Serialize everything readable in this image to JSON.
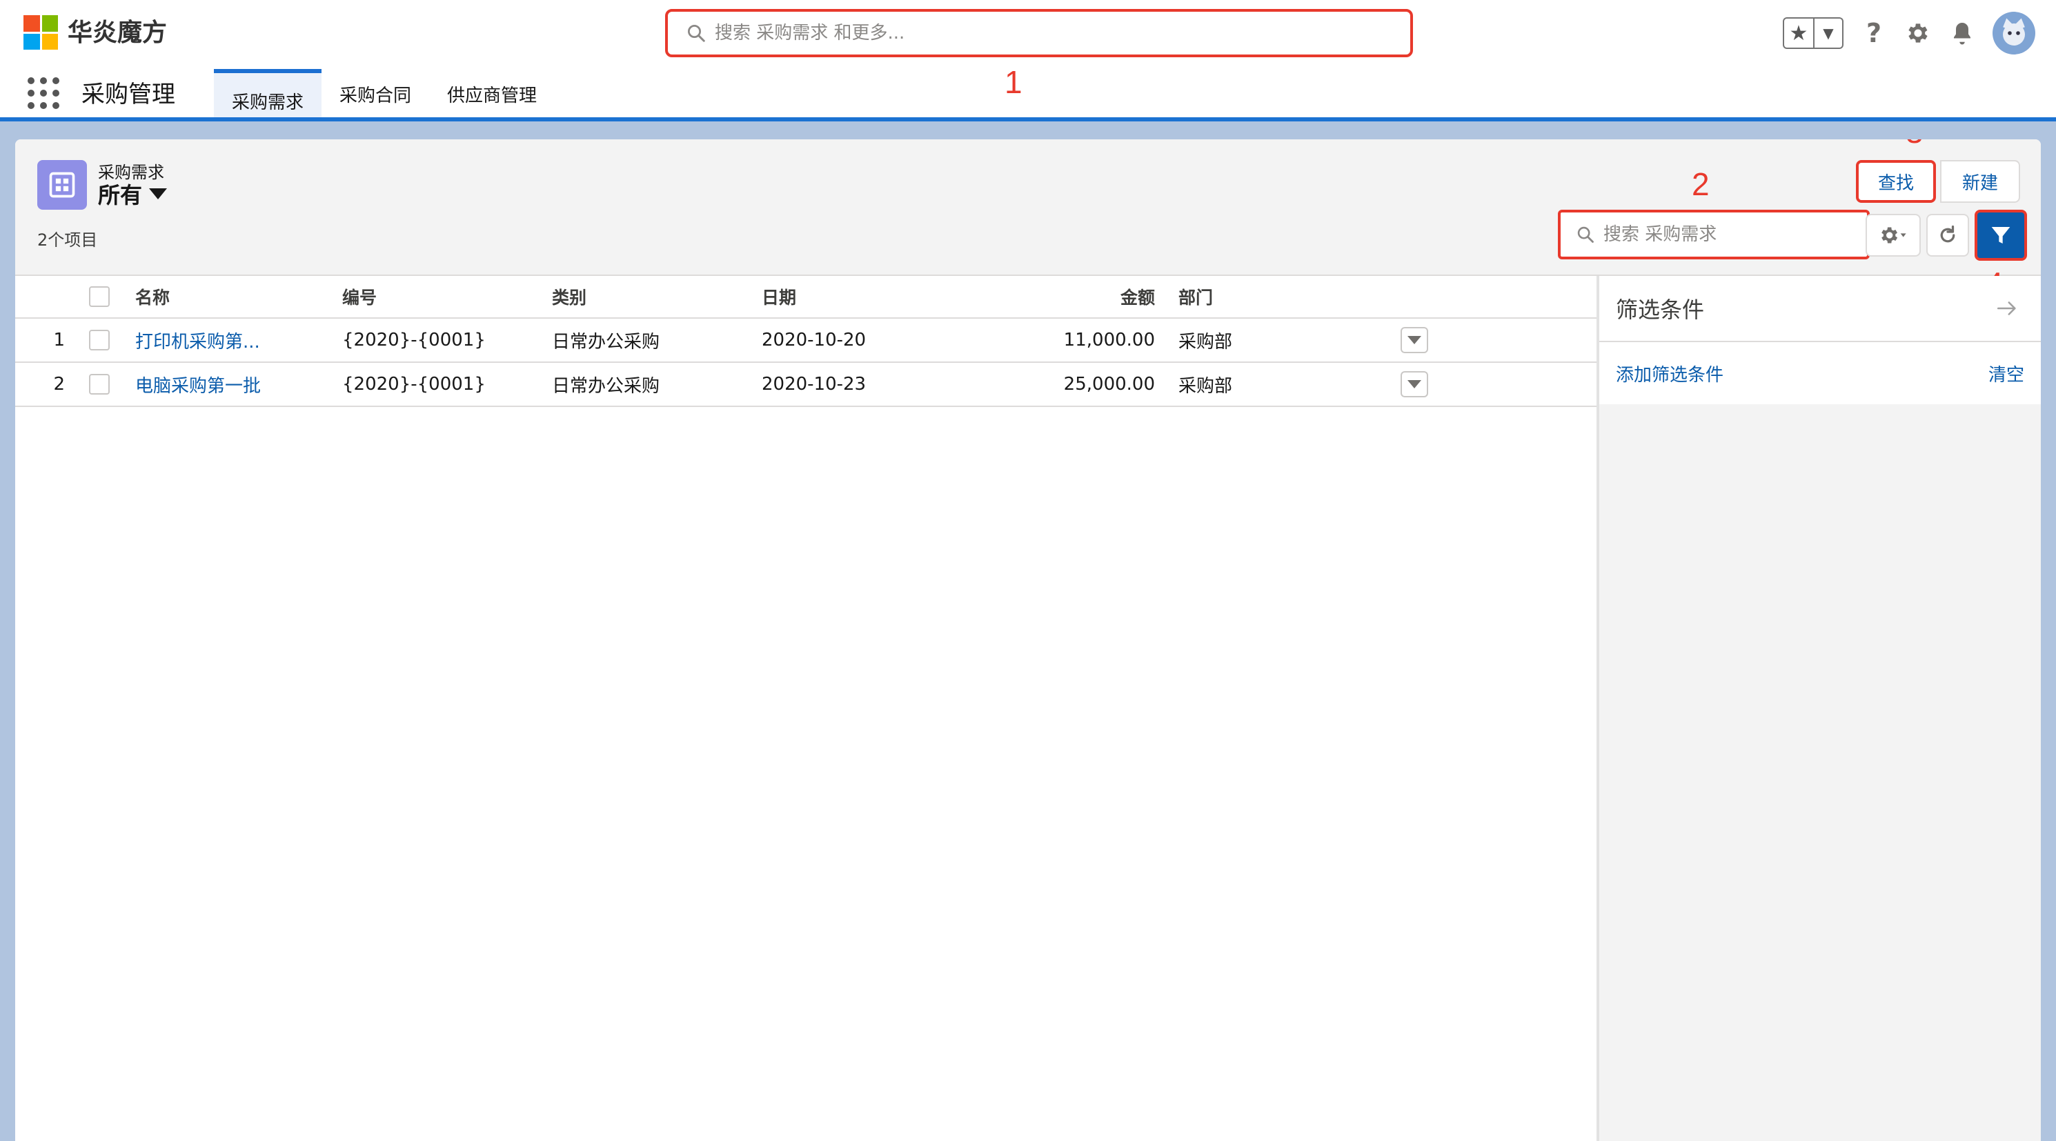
{
  "brand": {
    "name": "华炎魔方",
    "logo_colors": [
      "#f25022",
      "#7fba00",
      "#00a4ef",
      "#ffb900"
    ]
  },
  "global_search": {
    "placeholder": "搜索 采购需求 和更多..."
  },
  "callouts": {
    "one": "1",
    "two": "2",
    "three": "3",
    "four": "4"
  },
  "header_icons": [
    "star-icon",
    "chevron-down-icon",
    "help-icon",
    "gear-icon",
    "bell-icon",
    "avatar"
  ],
  "nav": {
    "app_name": "采购管理",
    "tabs": [
      {
        "label": "采购需求",
        "active": true
      },
      {
        "label": "采购合同",
        "active": false
      },
      {
        "label": "供应商管理",
        "active": false
      }
    ]
  },
  "list": {
    "object_label": "采购需求",
    "view_name": "所有",
    "item_count": "2个项目",
    "find_button": "查找",
    "new_button": "新建",
    "search_placeholder": "搜索 采购需求",
    "columns": {
      "name": "名称",
      "code": "编号",
      "category": "类别",
      "date": "日期",
      "amount": "金额",
      "dept": "部门"
    },
    "rows": [
      {
        "num": "1",
        "name": "打印机采购第...",
        "code": "{2020}-{0001}",
        "category": "日常办公采购",
        "date": "2020-10-20",
        "amount": "11,000.00",
        "dept": "采购部"
      },
      {
        "num": "2",
        "name": "电脑采购第一批",
        "code": "{2020}-{0001}",
        "category": "日常办公采购",
        "date": "2020-10-23",
        "amount": "25,000.00",
        "dept": "采购部"
      }
    ]
  },
  "filter_panel": {
    "title": "筛选条件",
    "add_link": "添加筛选条件",
    "clear_link": "清空"
  },
  "colors": {
    "accent": "#1b72d2",
    "link": "#0b5cab",
    "highlight": "#e8392c",
    "object_icon": "#8f8fe6"
  }
}
